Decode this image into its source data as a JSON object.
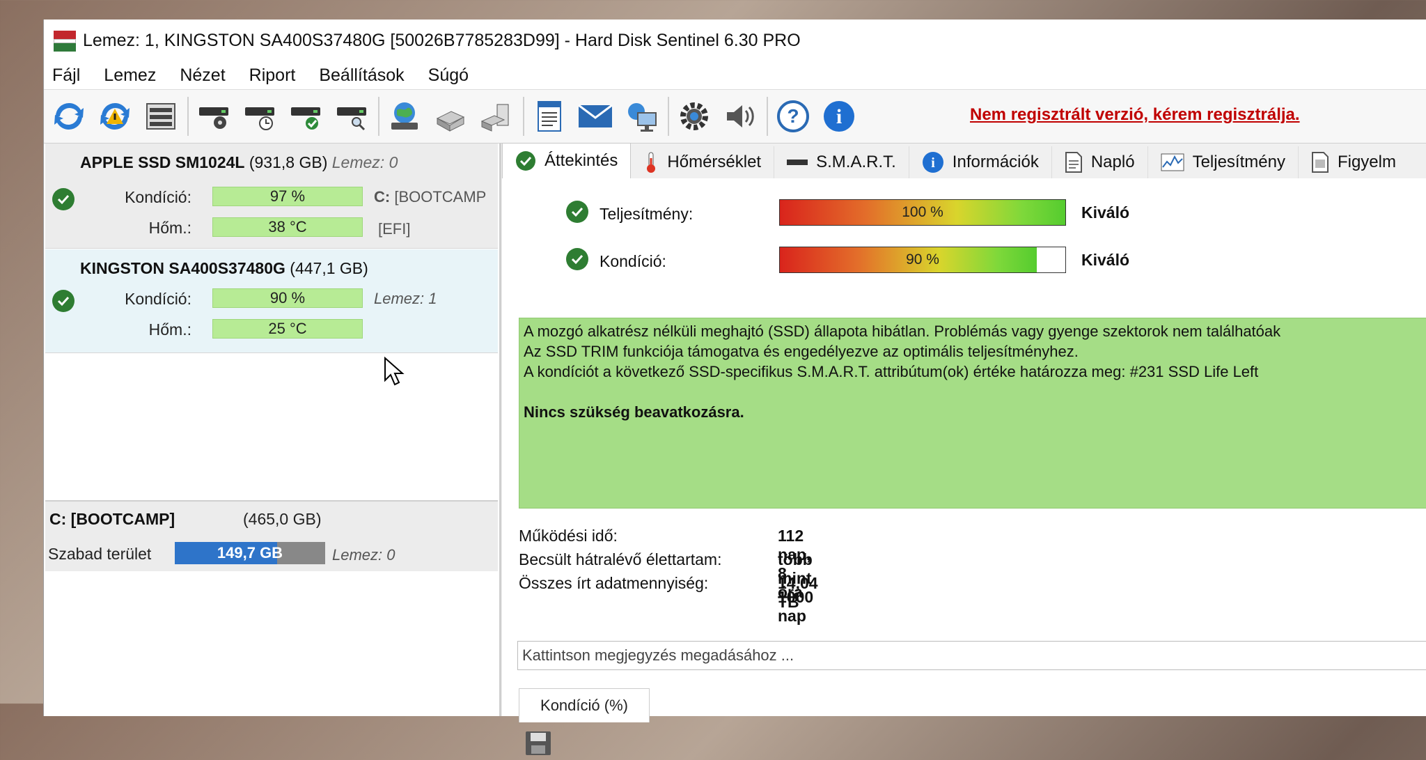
{
  "window": {
    "title": "Lemez: 1, KINGSTON SA400S37480G [50026B7785283D99]  -  Hard Disk Sentinel 6.30 PRO"
  },
  "menu": [
    "Fájl",
    "Lemez",
    "Nézet",
    "Riport",
    "Beállítások",
    "Súgó"
  ],
  "toolbar": {
    "icons": [
      "refresh-icon",
      "refresh-warning-icon",
      "disk-list-icon",
      "disk-surface-icon",
      "disk-schedule-icon",
      "disk-ok-icon",
      "disk-search-icon",
      "network-icon",
      "usb-disk-icon",
      "external-disk-icon",
      "report-icon",
      "email-icon",
      "web-monitor-icon",
      "settings-gear-icon",
      "sound-icon",
      "help-icon",
      "info-icon"
    ],
    "register_text": "Nem regisztrált verzió, kérem regisztrálja."
  },
  "disks": [
    {
      "name": "APPLE SSD SM1024L",
      "size": "(931,8 GB)",
      "disk_ref": "Lemez: 0",
      "health_label": "Kondíció:",
      "health": "97 %",
      "temp_label": "Hőm.:",
      "temp": "38 °C",
      "vol1": "C:",
      "vol1_name": "[BOOTCAMP",
      "vol2": "[EFI]"
    },
    {
      "name": "KINGSTON SA400S37480G",
      "size": "(447,1 GB)",
      "disk_ref": "Lemez: 1",
      "health_label": "Kondíció:",
      "health": "90 %",
      "temp_label": "Hőm.:",
      "temp": "25 °C"
    }
  ],
  "volume": {
    "name": "C: [BOOTCAMP]",
    "size": "(465,0 GB)",
    "free_label": "Szabad terület",
    "free": "149,7 GB",
    "free_fraction": 0.68,
    "disk_ref": "Lemez: 0"
  },
  "tabs": [
    {
      "label": "Áttekintés",
      "icon": "check-icon"
    },
    {
      "label": "Hőmérséklet",
      "icon": "thermometer-icon"
    },
    {
      "label": "S.M.A.R.T.",
      "icon": "smart-icon"
    },
    {
      "label": "Információk",
      "icon": "info-icon"
    },
    {
      "label": "Napló",
      "icon": "log-icon"
    },
    {
      "label": "Teljesítmény",
      "icon": "performance-icon"
    },
    {
      "label": "Figyelm",
      "icon": "alerts-icon"
    }
  ],
  "overview": {
    "performance_label": "Teljesítmény:",
    "performance": "100 %",
    "performance_fraction": 1.0,
    "performance_status": "Kiváló",
    "health_label": "Kondíció:",
    "health": "90 %",
    "health_fraction": 0.9,
    "health_status": "Kiváló",
    "message_lines": [
      "A mozgó alkatrész nélküli meghajtó (SSD) állapota hibátlan. Problémás vagy gyenge szektorok nem találhatóak",
      "Az SSD TRIM funkciója támogatva és engedélyezve az optimális teljesítményhez.",
      "A kondíciót a következő SSD-specifikus S.M.A.R.T. attribútum(ok) értéke határozza meg:  #231 SSD Life Left"
    ],
    "message_bold": "Nincs szükség beavatkozásra.",
    "uptime_label": "Működési idő:",
    "uptime": "112 nap, 8 óra",
    "lifetime_label": "Becsült hátralévő élettartam:",
    "lifetime": "több mint 1000 nap",
    "written_label": "Összes írt adatmennyiség:",
    "written": "14,04 TB",
    "note_placeholder": "Kattintson megjegyzés megadásához ...",
    "subtab": "Kondíció  (%)"
  },
  "colors": {
    "health_green": "#b7eb95",
    "message_green": "#a5dd86",
    "register_red": "#c00000",
    "free_blue": "#2e74c9"
  }
}
